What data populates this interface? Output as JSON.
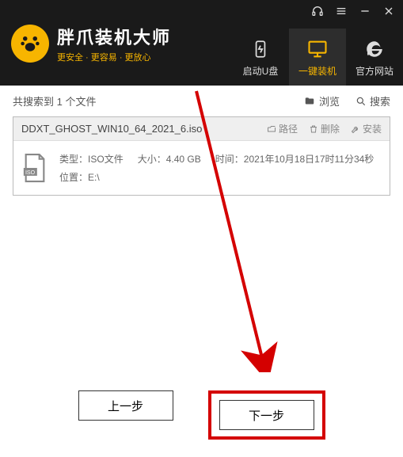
{
  "brand": {
    "title": "胖爪装机大师",
    "subtitle": "更安全 · 更容易 · 更放心"
  },
  "nav": {
    "usb": "启动U盘",
    "install": "一键装机",
    "site": "官方网站"
  },
  "toolbar": {
    "status": "共搜索到 1 个文件",
    "browse": "浏览",
    "search": "搜索"
  },
  "file": {
    "name": "DDXT_GHOST_WIN10_64_2021_6.iso",
    "path_btn": "路径",
    "delete_btn": "删除",
    "install_btn": "安装",
    "type_label": "类型：",
    "type_value": "ISO文件",
    "size_label": "大小：",
    "size_value": "4.40 GB",
    "time_label": "时间：",
    "time_value": "2021年10月18日17时11分34秒",
    "location_label": "位置：",
    "location_value": "E:\\"
  },
  "footer": {
    "prev": "上一步",
    "next": "下一步"
  }
}
